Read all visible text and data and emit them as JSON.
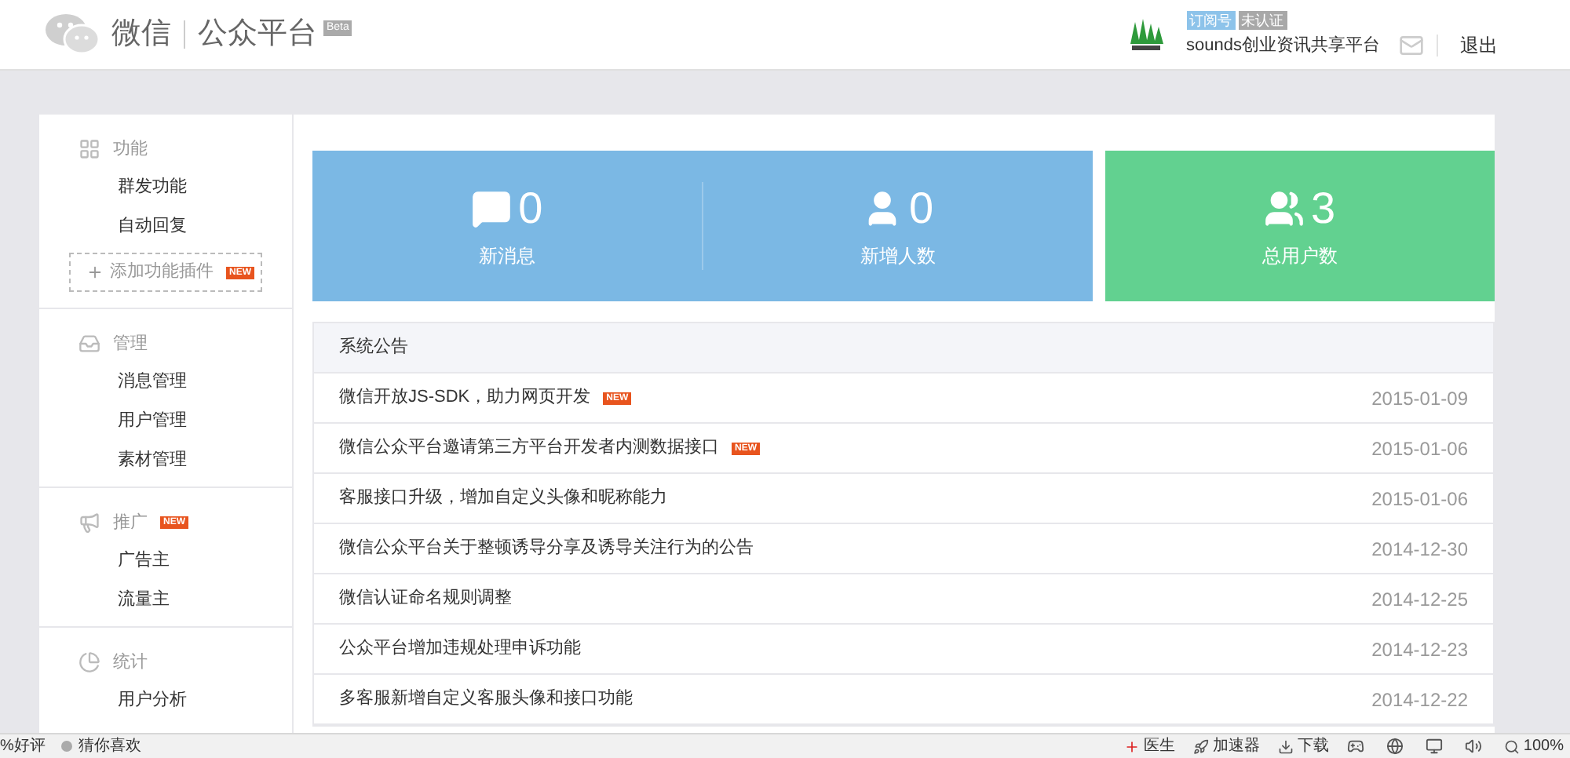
{
  "header": {
    "logo_text": "微信",
    "product": "公众平台",
    "beta": "Beta",
    "account": {
      "type_badge": "订阅号",
      "verify_badge": "未认证",
      "name": "sounds创业资讯共享平台",
      "logout": "退出"
    }
  },
  "sidebar": {
    "sections": [
      {
        "kind": "grid",
        "title": "功能",
        "items": [
          {
            "label": "群发功能"
          },
          {
            "label": "自动回复"
          }
        ],
        "add_plugin": {
          "label": "添加功能插件",
          "badge": "NEW"
        }
      },
      {
        "kind": "inbox",
        "title": "管理",
        "items": [
          {
            "label": "消息管理"
          },
          {
            "label": "用户管理"
          },
          {
            "label": "素材管理"
          }
        ]
      },
      {
        "kind": "megaphone",
        "title": "推广",
        "badge": "NEW",
        "items": [
          {
            "label": "广告主"
          },
          {
            "label": "流量主"
          }
        ]
      },
      {
        "kind": "pie",
        "title": "统计",
        "items": [
          {
            "label": "用户分析"
          }
        ]
      }
    ]
  },
  "stats": [
    {
      "kind": "message",
      "value": "0",
      "label": "新消息",
      "color": "#7bb8e4"
    },
    {
      "kind": "user",
      "value": "0",
      "label": "新增人数",
      "color": "#7bb8e4"
    },
    {
      "kind": "users",
      "value": "3",
      "label": "总用户数",
      "color": "#62d190"
    }
  ],
  "notices": {
    "title": "系统公告",
    "rows": [
      {
        "title": "微信开放JS-SDK，助力网页开发",
        "badge": "NEW",
        "date": "2015-01-09"
      },
      {
        "title": "微信公众平台邀请第三方平台开发者内测数据接口",
        "badge": "NEW",
        "date": "2015-01-06"
      },
      {
        "title": "客服接口升级，增加自定义头像和昵称能力",
        "date": "2015-01-06"
      },
      {
        "title": "微信公众平台关于整顿诱导分享及诱导关注行为的公告",
        "date": "2014-12-30"
      },
      {
        "title": "微信认证命名规则调整",
        "date": "2014-12-25"
      },
      {
        "title": "公众平台增加违规处理申诉功能",
        "date": "2014-12-23"
      },
      {
        "title": "多客服新增自定义客服头像和接口功能",
        "date": "2014-12-22"
      }
    ]
  },
  "status_bar": {
    "left": [
      "%好评",
      "猜你喜欢"
    ],
    "right": [
      {
        "kind": "doctor",
        "label": "医生"
      },
      {
        "kind": "accelerator",
        "label": "加速器"
      },
      {
        "kind": "download",
        "label": "下载"
      }
    ],
    "zoom": "100%"
  }
}
